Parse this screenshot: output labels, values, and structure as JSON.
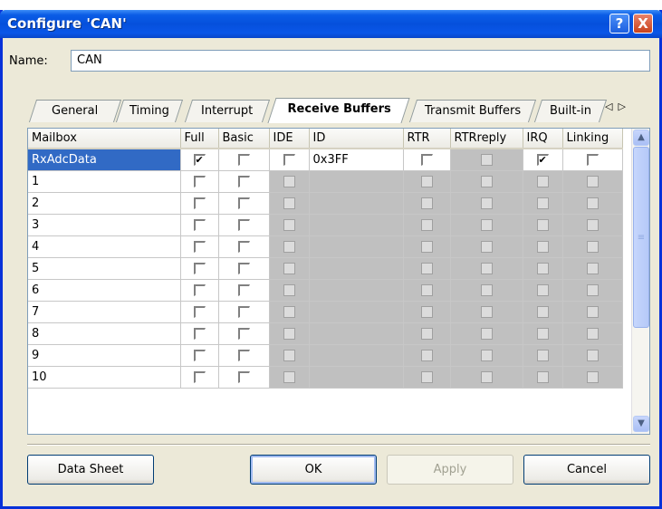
{
  "window": {
    "title": "Configure 'CAN'",
    "help_label": "?",
    "close_label": "X"
  },
  "name_field": {
    "label": "Name:",
    "value": "CAN"
  },
  "tabs": [
    {
      "label": "General"
    },
    {
      "label": "Timing"
    },
    {
      "label": "Interrupt"
    },
    {
      "label": "Receive Buffers"
    },
    {
      "label": "Transmit Buffers"
    },
    {
      "label": "Built-in"
    }
  ],
  "tab_scroll": {
    "left": "◁",
    "right": "▷"
  },
  "grid": {
    "columns": [
      "Mailbox",
      "Full",
      "Basic",
      "IDE",
      "ID",
      "RTR",
      "RTRreply",
      "IRQ",
      "Linking"
    ],
    "rows": [
      {
        "mailbox": "RxAdcData",
        "full": true,
        "basic": false,
        "ide": false,
        "id": "0x3FF",
        "rtr": false,
        "rtrreply": false,
        "irq": true,
        "linking": false
      },
      {
        "mailbox": "1",
        "id": ""
      },
      {
        "mailbox": "2",
        "id": ""
      },
      {
        "mailbox": "3",
        "id": ""
      },
      {
        "mailbox": "4",
        "id": ""
      },
      {
        "mailbox": "5",
        "id": ""
      },
      {
        "mailbox": "6",
        "id": ""
      },
      {
        "mailbox": "7",
        "id": ""
      },
      {
        "mailbox": "8",
        "id": ""
      },
      {
        "mailbox": "9",
        "id": ""
      },
      {
        "mailbox": "10",
        "id": ""
      }
    ]
  },
  "buttons": {
    "data_sheet": "Data Sheet",
    "ok": "OK",
    "apply": "Apply",
    "cancel": "Cancel"
  },
  "colors": {
    "title_bar": "#0a5ce6",
    "selection": "#316ac5",
    "disabled_cell": "#c0c0c0",
    "dialog": "#ece9d8"
  }
}
